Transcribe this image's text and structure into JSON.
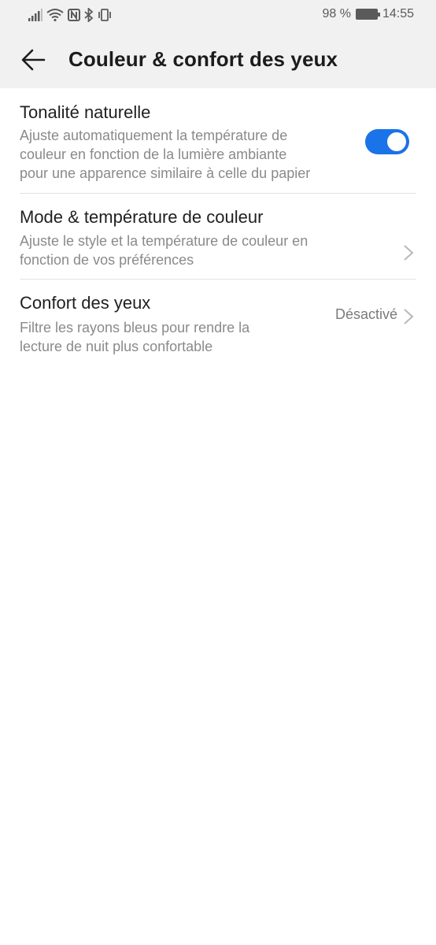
{
  "status_bar": {
    "battery_percent": "98 %",
    "time": "14:55",
    "icons": [
      "signal-icon",
      "wifi-icon",
      "nfc-icon",
      "bluetooth-icon",
      "vibrate-icon",
      "battery-icon"
    ]
  },
  "header": {
    "title": "Couleur & confort des yeux",
    "back_icon": "arrow-left-icon"
  },
  "settings": [
    {
      "title": "Tonalité naturelle",
      "description": "Ajuste automatiquement la température de\ncouleur en fonction de la lumière ambiante\npour une apparence similaire à celle du papier",
      "control": "toggle",
      "enabled": true
    },
    {
      "title": "Mode & température de couleur",
      "description": "Ajuste le style et la température de couleur en\nfonction de vos préférences",
      "control": "chevron"
    },
    {
      "title": "Confort des yeux",
      "description": "Filtre les rayons bleus pour rendre la\nlecture de nuit plus confortable",
      "value": "Désactivé",
      "control": "chevron"
    }
  ],
  "colors": {
    "accent": "#1a73e8",
    "header_bg": "#f1f1f1",
    "secondary_text": "#8a8a8a"
  }
}
